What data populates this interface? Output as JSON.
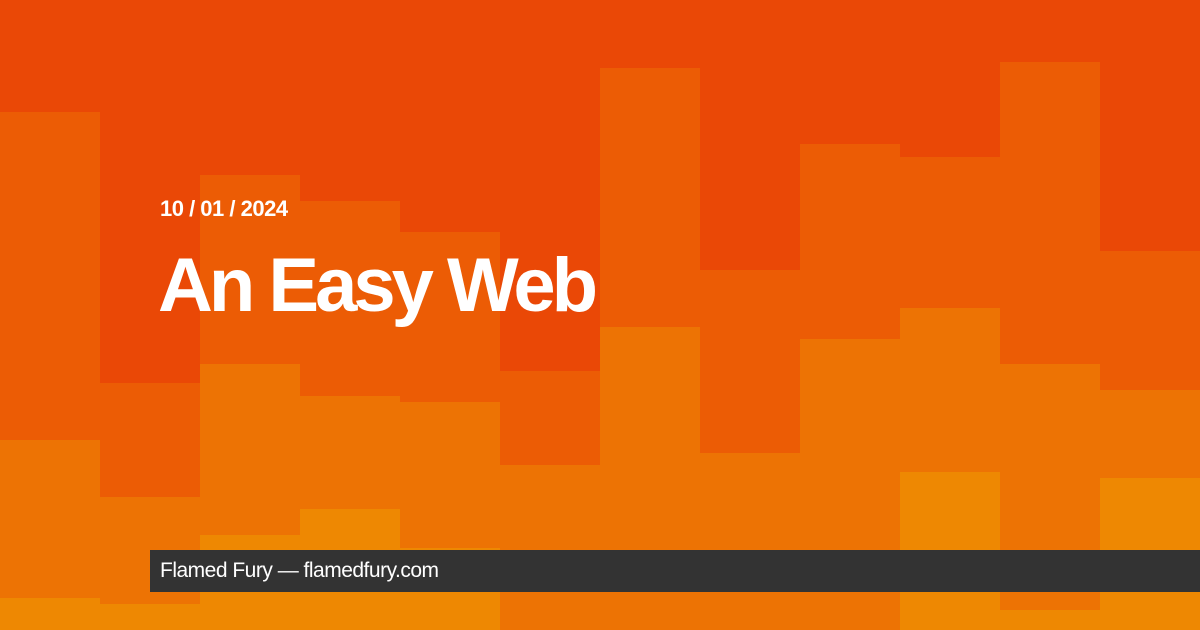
{
  "post": {
    "date": "10 / 01 / 2024",
    "title": "An Easy Web"
  },
  "footer": {
    "text": "Flamed Fury — flamedfury.com"
  },
  "colors": {
    "layer_1": "#ea4806",
    "layer_2": "#ec5c05",
    "layer_3": "#ed7304",
    "layer_4": "#ee8802",
    "footer_bar": "#333333",
    "text": "#ffffff"
  }
}
